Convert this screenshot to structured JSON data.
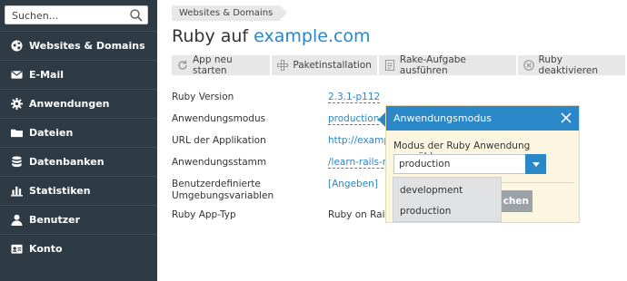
{
  "search": {
    "placeholder": "Suchen..."
  },
  "sidebar": {
    "items": [
      {
        "label": "Websites & Domains",
        "icon": "globe-icon"
      },
      {
        "label": "E-Mail",
        "icon": "mail-icon"
      },
      {
        "label": "Anwendungen",
        "icon": "gear-icon"
      },
      {
        "label": "Dateien",
        "icon": "folder-icon"
      },
      {
        "label": "Datenbanken",
        "icon": "database-icon"
      },
      {
        "label": "Statistiken",
        "icon": "bar-chart-icon"
      },
      {
        "label": "Benutzer",
        "icon": "user-icon"
      },
      {
        "label": "Konto",
        "icon": "id-card-icon"
      }
    ]
  },
  "breadcrumb": "Websites & Domains",
  "title": {
    "prefix": "Ruby auf",
    "domain": "example.com"
  },
  "toolbar": {
    "buttons": [
      {
        "label": "App neu starten",
        "icon": "restart-icon"
      },
      {
        "label": "Paketinstallation",
        "icon": "plus-icon"
      },
      {
        "label": "Rake-Aufgabe ausführen",
        "icon": "document-icon"
      },
      {
        "label": "Ruby deaktivieren",
        "icon": "disable-icon"
      }
    ]
  },
  "details": {
    "ruby_version": {
      "label": "Ruby Version",
      "value": "2.3.1-p112"
    },
    "mode": {
      "label": "Anwendungsmodus",
      "value": "production"
    },
    "url": {
      "label": "URL der Applikation",
      "value": "http://examp"
    },
    "root": {
      "label": "Anwendungsstamm",
      "value": "/learn-rails-n"
    },
    "env": {
      "label_line1": "Benutzerdefinierte",
      "label_line2": "Umgebungsvariablen",
      "value": "[Angeben]"
    },
    "app_type": {
      "label": "Ruby App-Typ",
      "value": "Ruby on Rails"
    }
  },
  "popover": {
    "title": "Anwendungsmodus",
    "prompt": "Modus der Ruby Anwendung auswählen:",
    "selected": "production",
    "options": [
      "development",
      "production"
    ],
    "hidden_button_fragment": "chen"
  },
  "colors": {
    "accent": "#2a87c8",
    "sidebar": "#2f3b44",
    "popover_bg": "#fcf6e0"
  }
}
